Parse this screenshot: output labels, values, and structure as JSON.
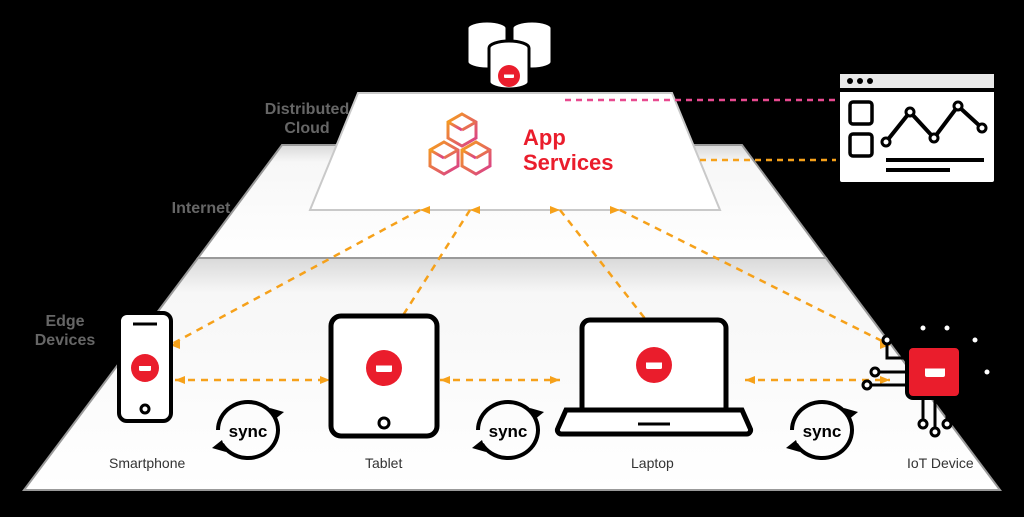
{
  "layers": {
    "cloud": "Distributed\nCloud",
    "internet": "Internet",
    "edge": "Edge\nDevices"
  },
  "app_services_label": "App\nServices",
  "devices": {
    "smartphone": "Smartphone",
    "tablet": "Tablet",
    "laptop": "Laptop",
    "iot": "IoT Device"
  },
  "sync_label": "sync",
  "colors": {
    "pyramid_stroke": "#9a9a9a",
    "brand_red": "#ea1d2c",
    "orange": "#f6a11a",
    "pink": "#e84a90",
    "cube_fill": "#fff",
    "cube_stroke_a": "#f15a24",
    "cube_stroke_b": "#ac2a8d"
  }
}
